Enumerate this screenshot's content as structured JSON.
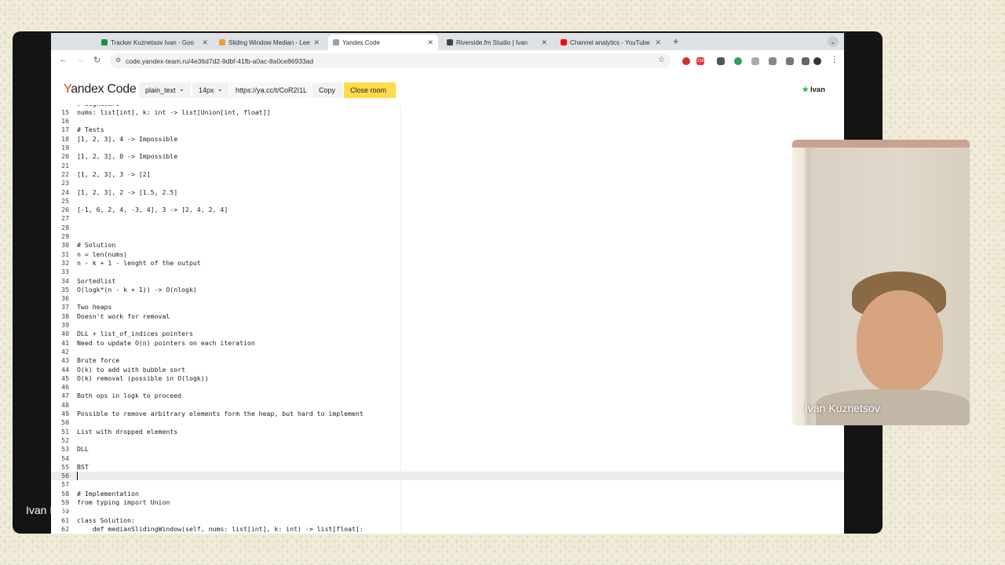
{
  "browser": {
    "tabs": [
      {
        "title": "Tracker Kuznetsov Ivan - Goo",
        "color": "#1e8e3e",
        "active": false
      },
      {
        "title": "Sliding Window Median - Leet",
        "color": "#f0a030",
        "active": false
      },
      {
        "title": "Yandex.Code",
        "color": "#9aa0a6",
        "active": true
      },
      {
        "title": "Riverside.fm Studio | Ivan",
        "color": "#444444",
        "active": false
      },
      {
        "title": "Channel analytics - YouTube",
        "color": "#ff0000",
        "active": false
      }
    ],
    "url": "code.yandex-team.ru/4e36d7d2-9dbf-41fb-a0ac-8a0ce86933ad",
    "extension_badge": "218"
  },
  "app": {
    "logo_y": "Y",
    "logo_rest": "andex Code",
    "syntax": "plain_text",
    "font_size": "14px",
    "room_link": "https://ya.cc/t/CoR2I1L",
    "copy_label": "Copy",
    "close_label": "Close room",
    "user": "Ivan",
    "user_star": "★"
  },
  "editor": {
    "cursor_line": 56,
    "lines": [
      {
        "n": "",
        "t": "# Signature"
      },
      {
        "n": "15",
        "t": "nums: list[int], k: int -> list[Union[int, float]]"
      },
      {
        "n": "16",
        "t": ""
      },
      {
        "n": "17",
        "t": "# Tests"
      },
      {
        "n": "18",
        "t": "[1, 2, 3], 4 -> Impossible"
      },
      {
        "n": "19",
        "t": ""
      },
      {
        "n": "20",
        "t": "[1, 2, 3], 0 -> Impossible"
      },
      {
        "n": "21",
        "t": ""
      },
      {
        "n": "22",
        "t": "[1, 2, 3], 3 -> [2]"
      },
      {
        "n": "23",
        "t": ""
      },
      {
        "n": "24",
        "t": "[1, 2, 3], 2 -> [1.5, 2.5]"
      },
      {
        "n": "25",
        "t": ""
      },
      {
        "n": "26",
        "t": "[-1, 6, 2, 4, -3, 4], 3 -> [2, 4, 2, 4]"
      },
      {
        "n": "27",
        "t": ""
      },
      {
        "n": "28",
        "t": ""
      },
      {
        "n": "29",
        "t": ""
      },
      {
        "n": "30",
        "t": "# Solution"
      },
      {
        "n": "31",
        "t": "n = len(nums)"
      },
      {
        "n": "32",
        "t": "n - k + 1 - lenght of the output"
      },
      {
        "n": "33",
        "t": ""
      },
      {
        "n": "34",
        "t": "Sortedlist"
      },
      {
        "n": "35",
        "t": "O(logk*(n - k + 1)) -> O(nlogk)"
      },
      {
        "n": "36",
        "t": ""
      },
      {
        "n": "37",
        "t": "Two heaps"
      },
      {
        "n": "38",
        "t": "Doesn't work for removal"
      },
      {
        "n": "39",
        "t": ""
      },
      {
        "n": "40",
        "t": "DLL + list_of_indices pointers"
      },
      {
        "n": "41",
        "t": "Need to update O(n) pointers on each iteration"
      },
      {
        "n": "42",
        "t": ""
      },
      {
        "n": "43",
        "t": "Brute force"
      },
      {
        "n": "44",
        "t": "O(k) to add with bubble sort"
      },
      {
        "n": "45",
        "t": "O(k) removal (possible in O(logk))"
      },
      {
        "n": "46",
        "t": ""
      },
      {
        "n": "47",
        "t": "Both ops in logk to proceed"
      },
      {
        "n": "48",
        "t": ""
      },
      {
        "n": "49",
        "t": "Possible to remove arbitrary elements form the heap, but hard to implement"
      },
      {
        "n": "50",
        "t": ""
      },
      {
        "n": "51",
        "t": "List with dropped elements"
      },
      {
        "n": "52",
        "t": ""
      },
      {
        "n": "53",
        "t": "DLL"
      },
      {
        "n": "54",
        "t": ""
      },
      {
        "n": "55",
        "t": "BST"
      },
      {
        "n": "56",
        "t": ""
      },
      {
        "n": "57",
        "t": ""
      },
      {
        "n": "58",
        "t": "# Implementation"
      },
      {
        "n": "59",
        "t": "from typing import Union"
      },
      {
        "n": "60",
        "t": ""
      },
      {
        "n": "61",
        "t": "class Solution:"
      },
      {
        "n": "62",
        "t": "    def medianSlidingWindow(self, nums: list[int], k: int) -> list[float]:"
      }
    ]
  },
  "video": {
    "name": "Ivan Kuznetsov"
  },
  "caption": "Ivan Kuznetsov"
}
